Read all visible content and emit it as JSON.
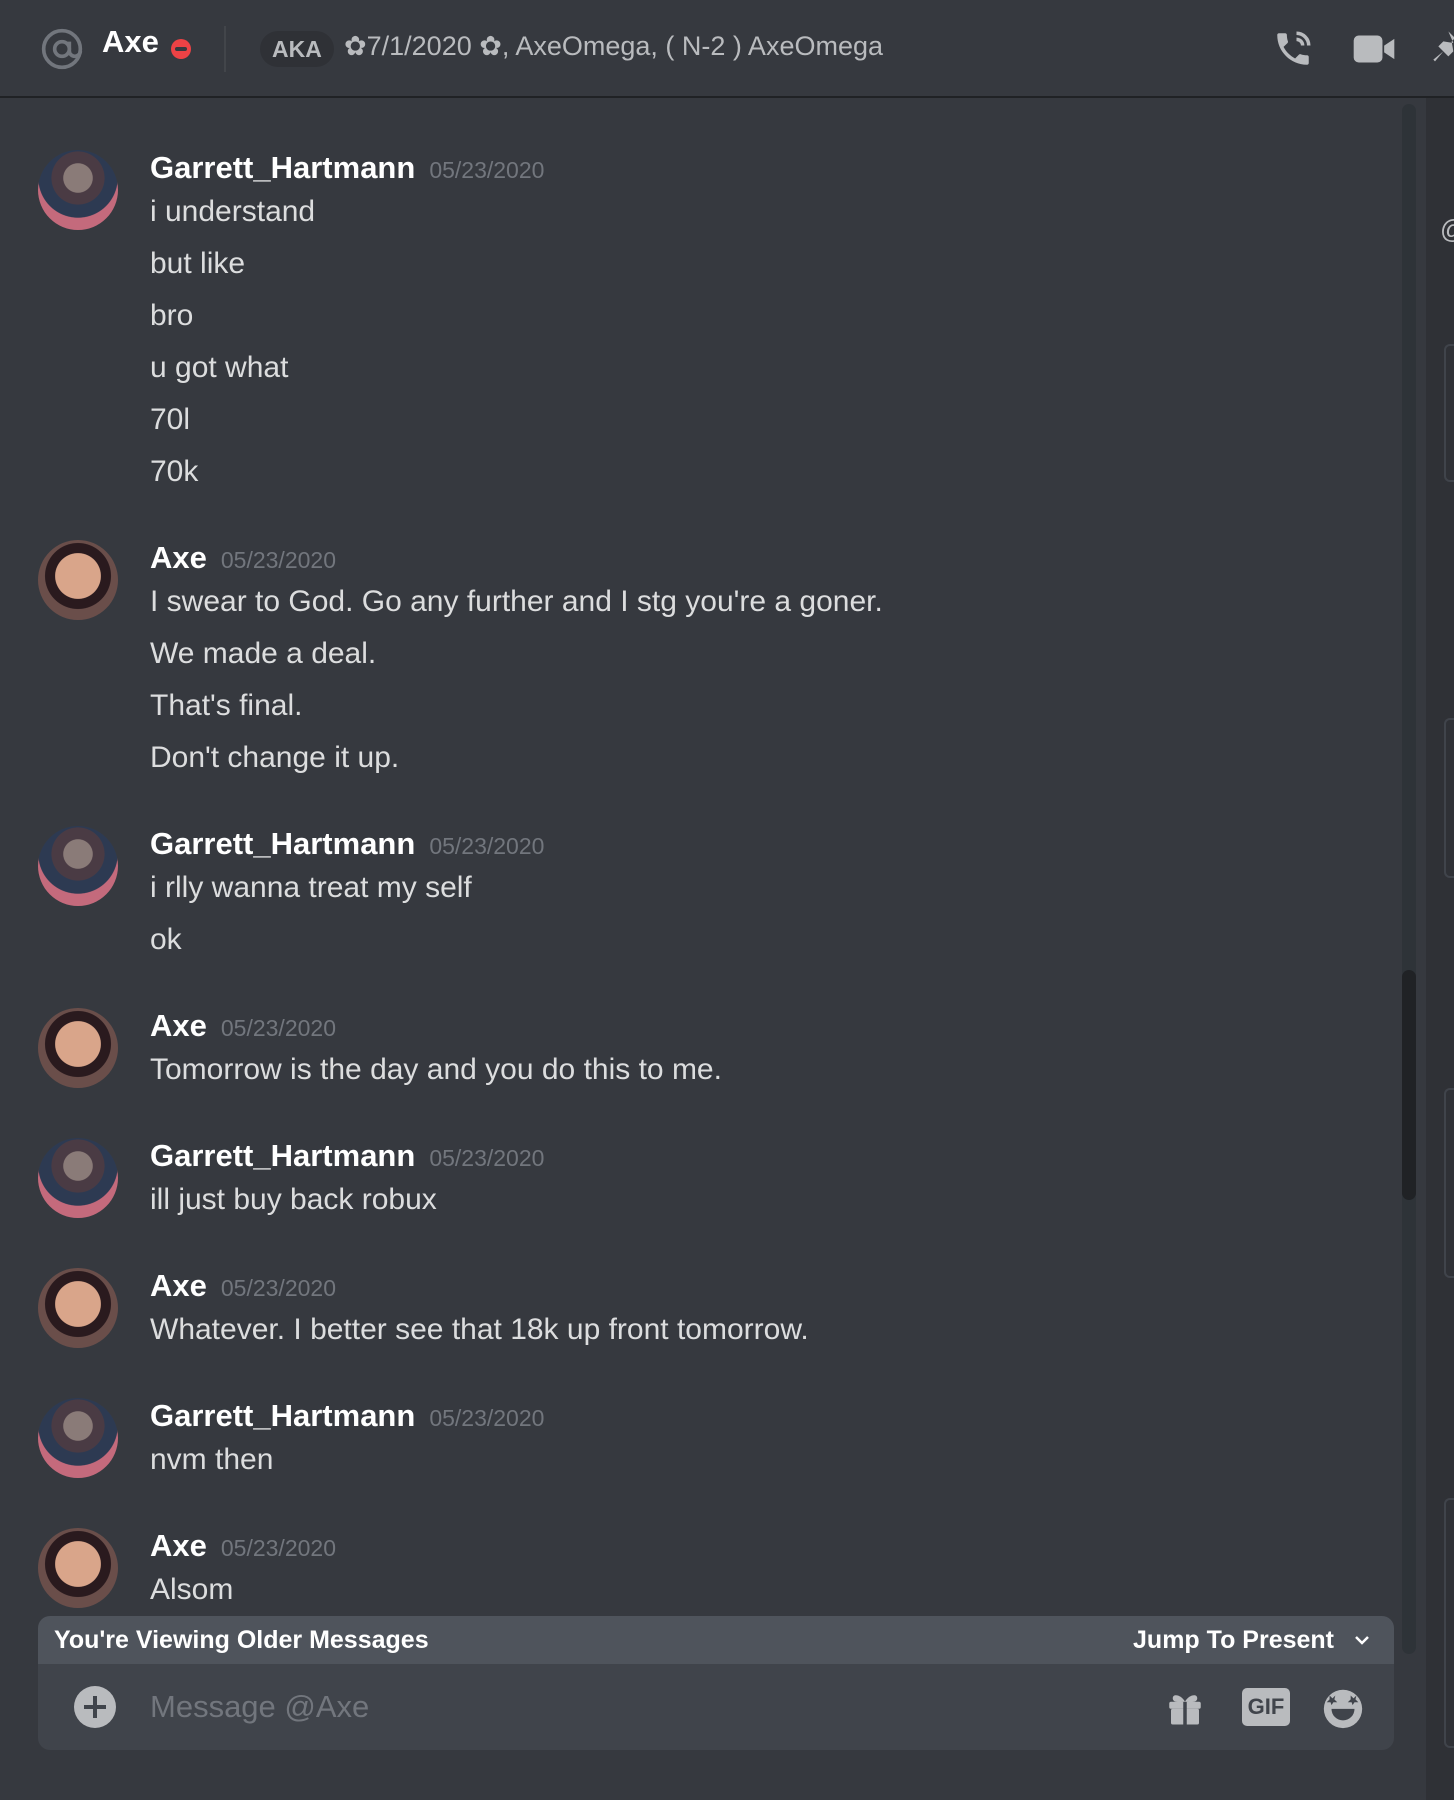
{
  "header": {
    "name": "Axe",
    "badge": "AKA",
    "nicknames": "✿7/1/2020 ✿, AxeOmega, ( N-2 ) AxeOmega"
  },
  "messages": [
    {
      "author": "Garrett_Hartmann",
      "time": "05/23/2020",
      "avatar": "garrett-avatar",
      "lines": [
        "i understand",
        "but like",
        "bro",
        "u got what",
        "70l",
        "70k"
      ]
    },
    {
      "author": "Axe",
      "time": "05/23/2020",
      "avatar": "axe-avatar",
      "lines": [
        "I swear to God. Go any further and I stg you're a goner.",
        "We made a deal.",
        "That's final.",
        "Don't change it up."
      ]
    },
    {
      "author": "Garrett_Hartmann",
      "time": "05/23/2020",
      "avatar": "garrett-avatar",
      "lines": [
        "i rlly wanna treat my self",
        "ok"
      ]
    },
    {
      "author": "Axe",
      "time": "05/23/2020",
      "avatar": "axe-avatar",
      "lines": [
        "Tomorrow is the day and you do this to me."
      ]
    },
    {
      "author": "Garrett_Hartmann",
      "time": "05/23/2020",
      "avatar": "garrett-avatar",
      "lines": [
        "ill just buy back robux"
      ]
    },
    {
      "author": "Axe",
      "time": "05/23/2020",
      "avatar": "axe-avatar",
      "lines": [
        "Whatever. I better see that 18k up front tomorrow."
      ]
    },
    {
      "author": "Garrett_Hartmann",
      "time": "05/23/2020",
      "avatar": "garrett-avatar",
      "lines": [
        "nvm then"
      ]
    },
    {
      "author": "Axe",
      "time": "05/23/2020",
      "avatar": "axe-avatar",
      "lines": [
        "Alsom"
      ]
    }
  ],
  "older_bar": {
    "text": "You're Viewing Older Messages",
    "jump": "Jump To Present"
  },
  "composer": {
    "placeholder": "Message @Axe",
    "gif": "GIF"
  },
  "colors": {
    "background": "#36393f",
    "dnd": "#ed4245",
    "timestamp": "#72767d"
  }
}
